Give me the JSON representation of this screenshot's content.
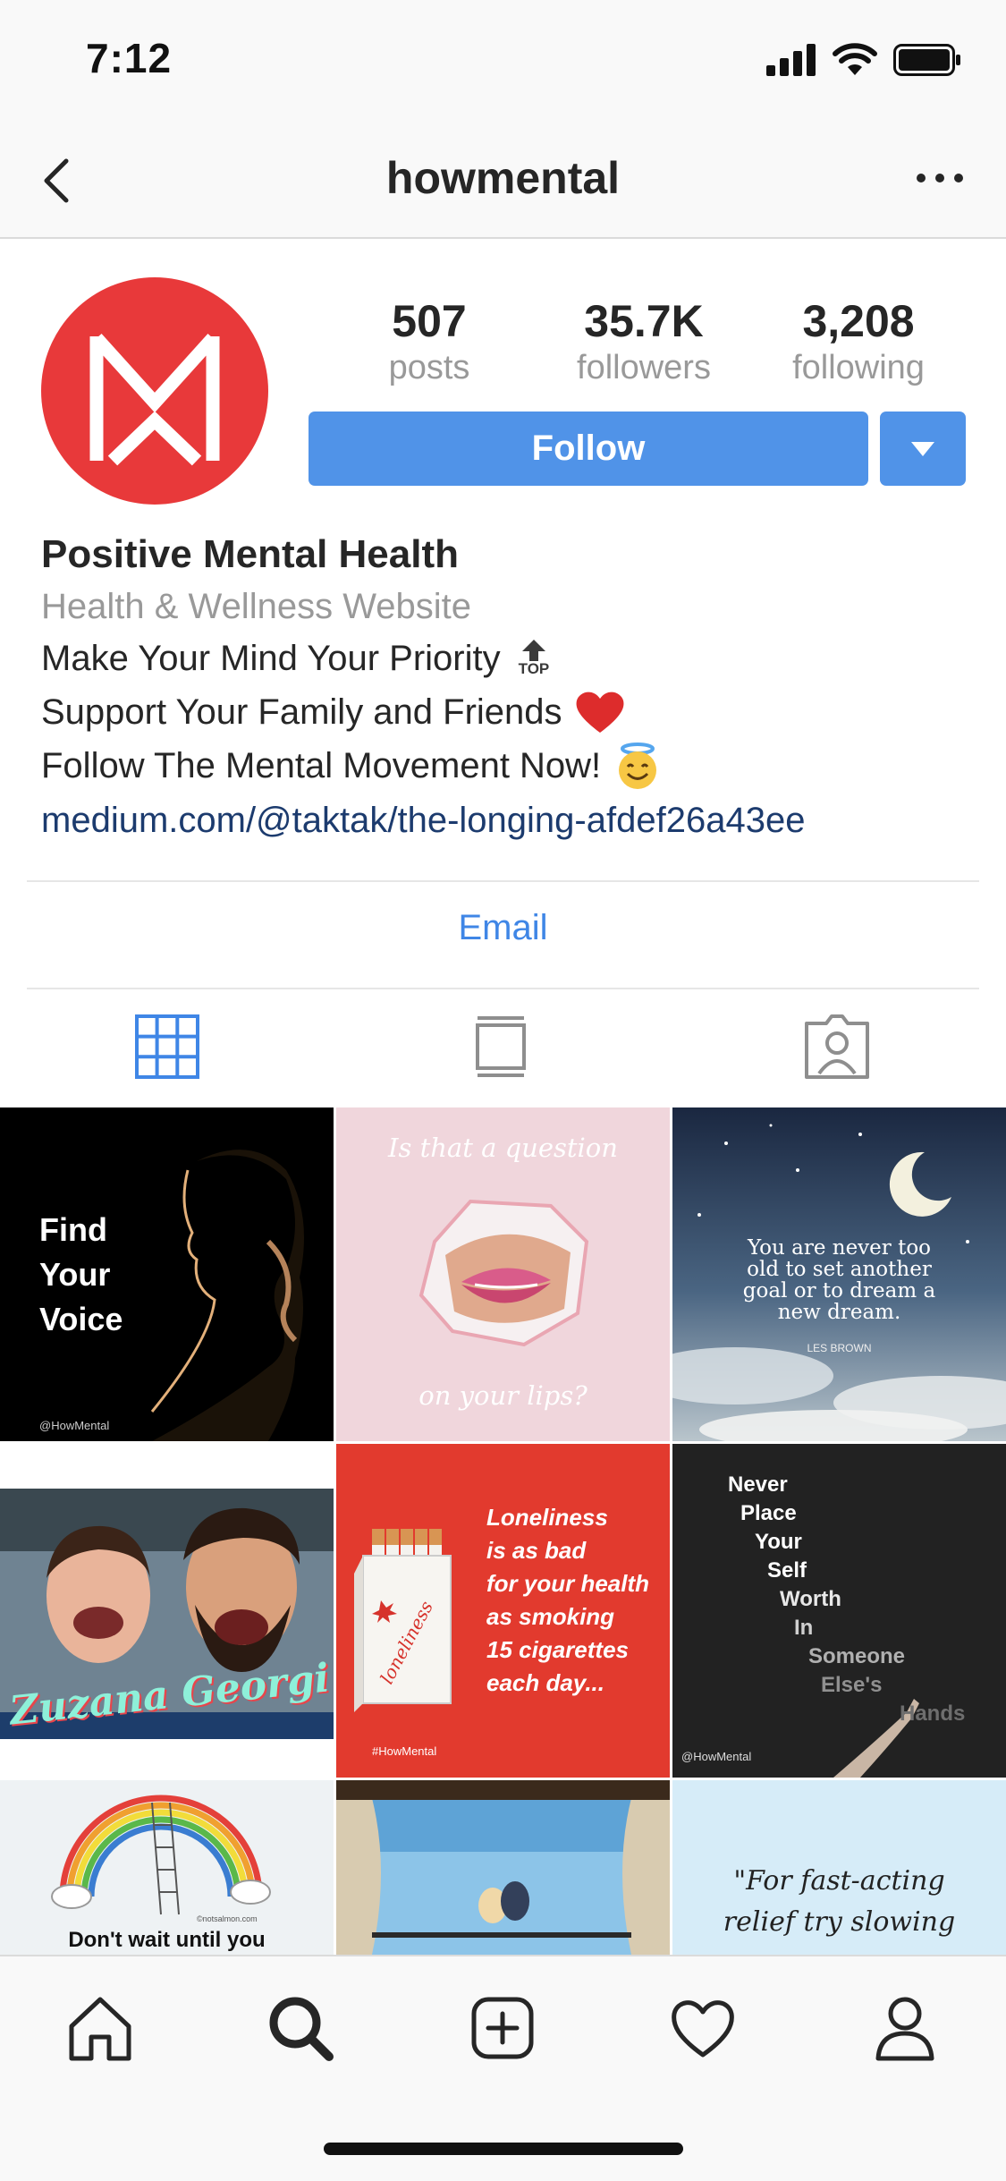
{
  "status_bar": {
    "time": "7:12"
  },
  "header": {
    "title": "howmental"
  },
  "stats": [
    {
      "value": "507",
      "label": "posts"
    },
    {
      "value": "35.7K",
      "label": "followers"
    },
    {
      "value": "3,208",
      "label": "following"
    }
  ],
  "actions": {
    "follow_label": "Follow"
  },
  "bio": {
    "name": "Positive Mental Health",
    "category": "Health & Wellness Website",
    "line1": "Make Your Mind Your Priority",
    "line1_badge": "TOP",
    "line2": "Support Your Family and Friends",
    "line3": "Follow The Mental Movement Now!",
    "link": "medium.com/@taktak/the-longing-afdef26a43ee"
  },
  "contact": {
    "email_label": "Email"
  },
  "posts": {
    "p1": {
      "title": [
        "Find",
        "Your",
        "Voice"
      ],
      "handle": "@HowMental"
    },
    "p2": {
      "top": "Is that a question",
      "bottom": "on your lips?"
    },
    "p3": {
      "quote": [
        "You are never too",
        "old to set another",
        "goal or to dream a",
        "new dream."
      ],
      "author": "LES BROWN"
    },
    "p4": {
      "scribble": "Zuzana Georgi"
    },
    "p5": {
      "text": [
        "Loneliness",
        "is as bad",
        "for your health",
        "as smoking",
        "15 cigarettes",
        "each day..."
      ],
      "pack": "loneliness",
      "handle": "#HowMental"
    },
    "p6": {
      "words": [
        "Never",
        "Place",
        "Your",
        "Self",
        "Worth",
        "In",
        "Someone",
        "Else's",
        "Hands"
      ],
      "handle": "@HowMental"
    },
    "p7": {
      "text": "Don't wait until you",
      "small": "©notsalmon.com"
    },
    "p9": {
      "text": [
        "\"For fast-acting",
        "relief try slowing"
      ]
    }
  },
  "icons": {
    "back": "chevron-left-icon",
    "more": "more-horizontal-icon",
    "grid": "grid-icon",
    "feed": "feed-icon",
    "tagged": "tagged-icon",
    "home": "home-icon",
    "search": "search-icon",
    "add": "add-post-icon",
    "heart": "heart-icon",
    "profile": "profile-icon"
  },
  "colors": {
    "accent": "#5093e8",
    "link": "#1c3b6e",
    "avatar_bg": "#e8393a",
    "email": "#3f86e6"
  }
}
